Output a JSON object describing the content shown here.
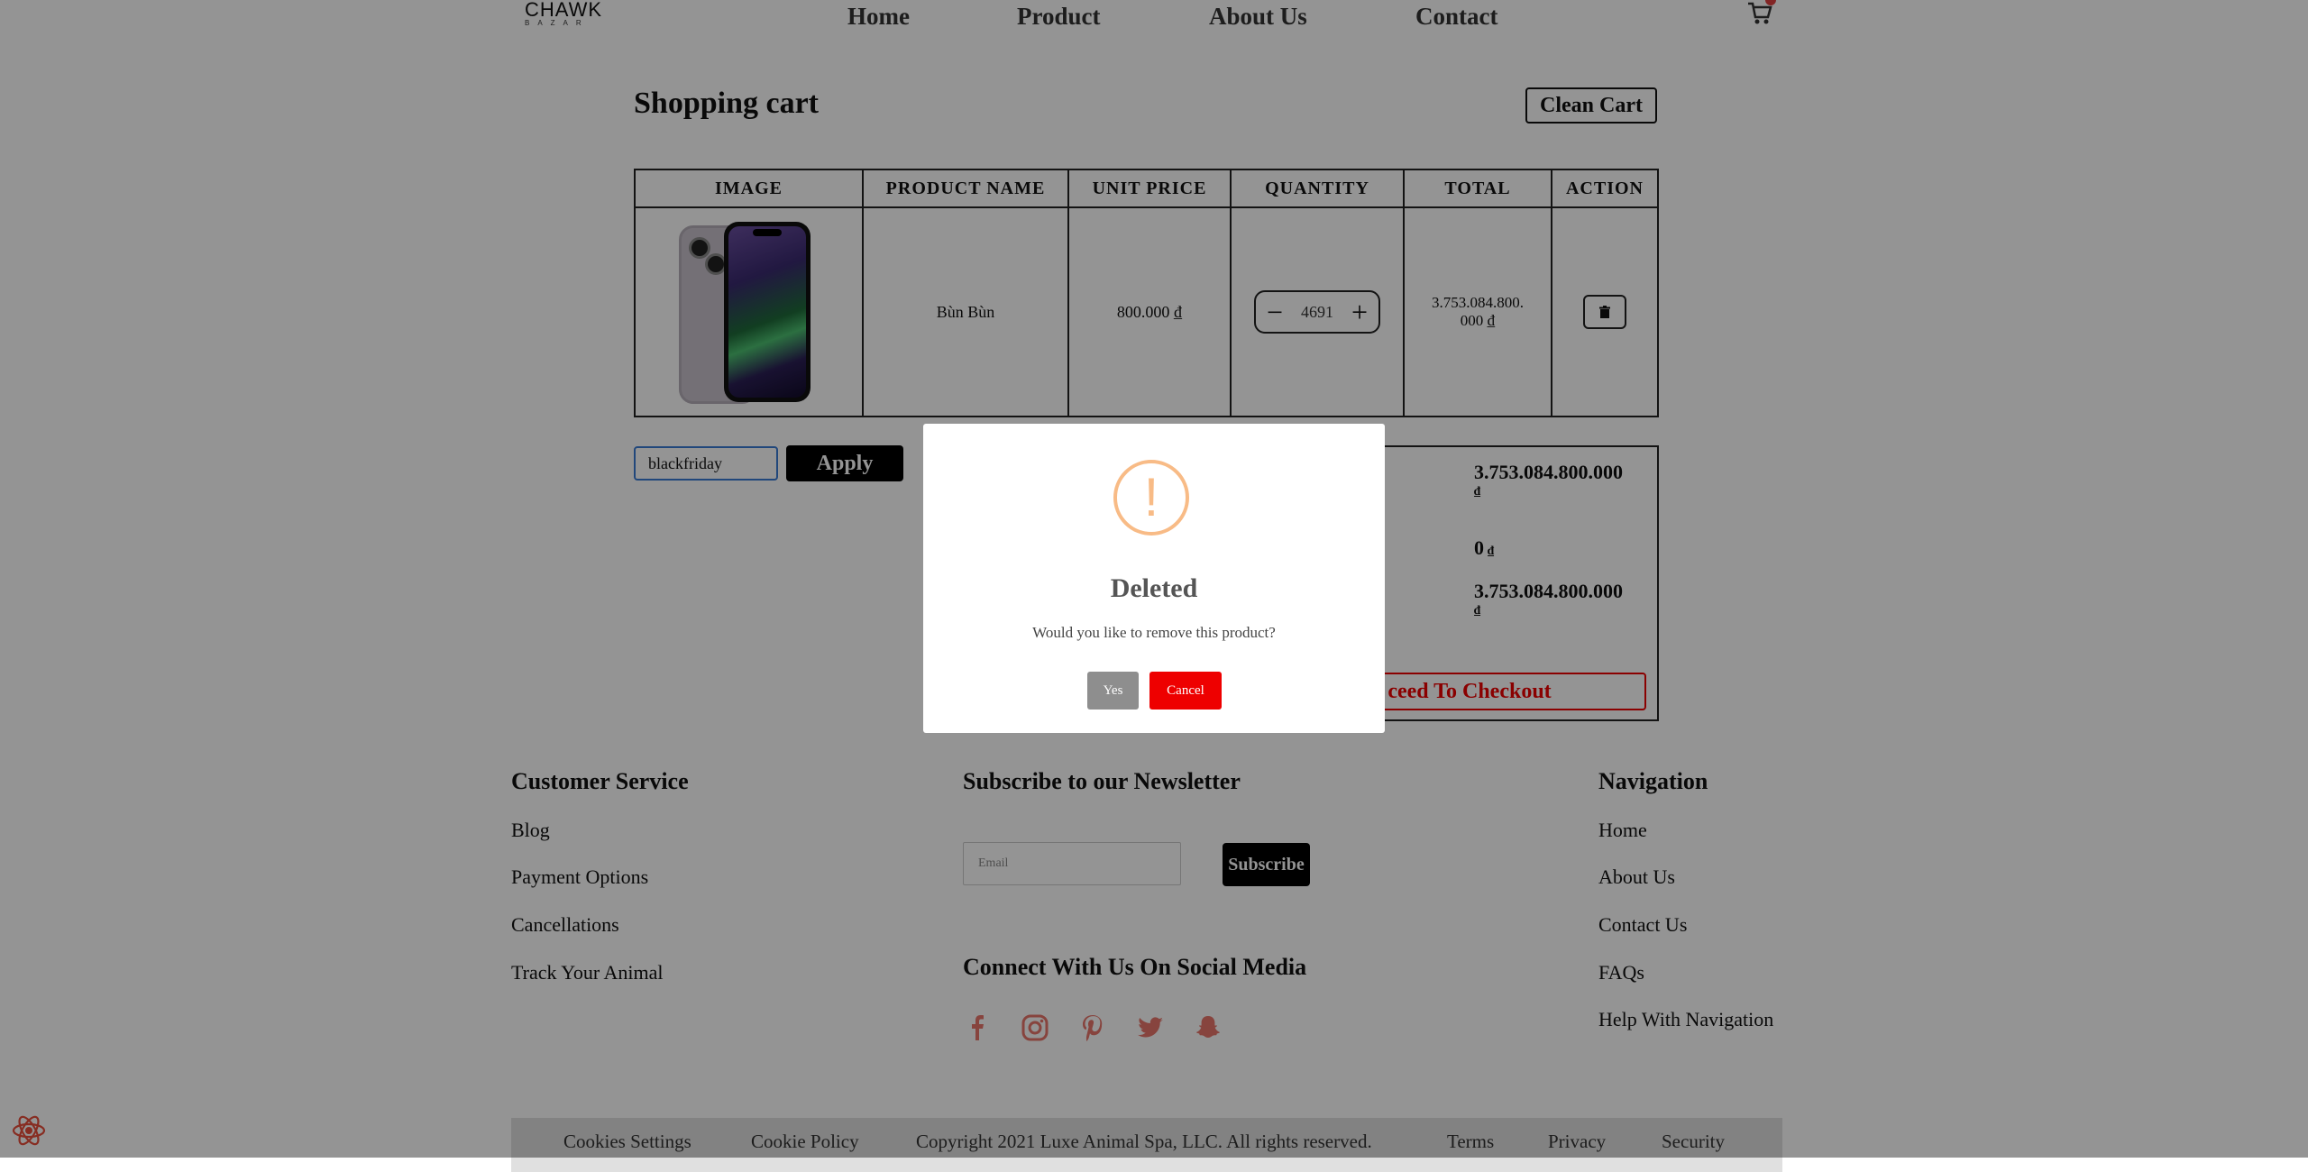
{
  "header": {
    "logo_top": "CHAWK",
    "logo_bottom": "BAZAR",
    "nav": [
      "Home",
      "Product",
      "About Us",
      "Contact"
    ]
  },
  "cart": {
    "title": "Shopping cart",
    "clean_label": "Clean Cart",
    "columns": [
      "IMAGE",
      "PRODUCT NAME",
      "UNIT PRICE",
      "QUANTITY",
      "TOTAL",
      "ACTION"
    ],
    "item": {
      "name": "Bùn Bùn",
      "unit_price": "800.000 ₫",
      "quantity": "4691",
      "total": "3.753.084.800.000 ₫"
    },
    "coupon_value": "blackfriday",
    "apply_label": "Apply",
    "subtotal": "3.753.084.800.000",
    "discount": "0",
    "grand_total": "3.753.084.800.000",
    "currency": "₫",
    "checkout_label": "ceed To Checkout"
  },
  "footer": {
    "customer_service": {
      "title": "Customer Service",
      "links": [
        "Blog",
        "Payment Options",
        "Cancellations",
        "Track Your Animal"
      ]
    },
    "newsletter": {
      "title": "Subscribe to our Newsletter",
      "email_placeholder": "Email",
      "subscribe_label": "Subscribe",
      "social_title": "Connect With Us On Social Media",
      "social_icons": [
        "facebook-icon",
        "instagram-icon",
        "pinterest-icon",
        "twitter-icon",
        "snapchat-icon"
      ],
      "social_color": "#e9766b"
    },
    "navigation": {
      "title": "Navigation",
      "links": [
        "Home",
        "About Us",
        "Contact Us",
        "FAQs",
        "Help With Navigation"
      ]
    },
    "bottom": [
      "Cookies Settings",
      "Cookie Policy",
      "Copyright 2021 Luxe Animal Spa, LLC. All rights reserved.",
      "Terms",
      "Privacy",
      "Security"
    ]
  },
  "modal": {
    "icon": "!",
    "title": "Deleted",
    "text": "Would you like to remove this product?",
    "yes_label": "Yes",
    "cancel_label": "Cancel",
    "warning_color": "#f8bb86",
    "cancel_color": "#ee0000"
  }
}
